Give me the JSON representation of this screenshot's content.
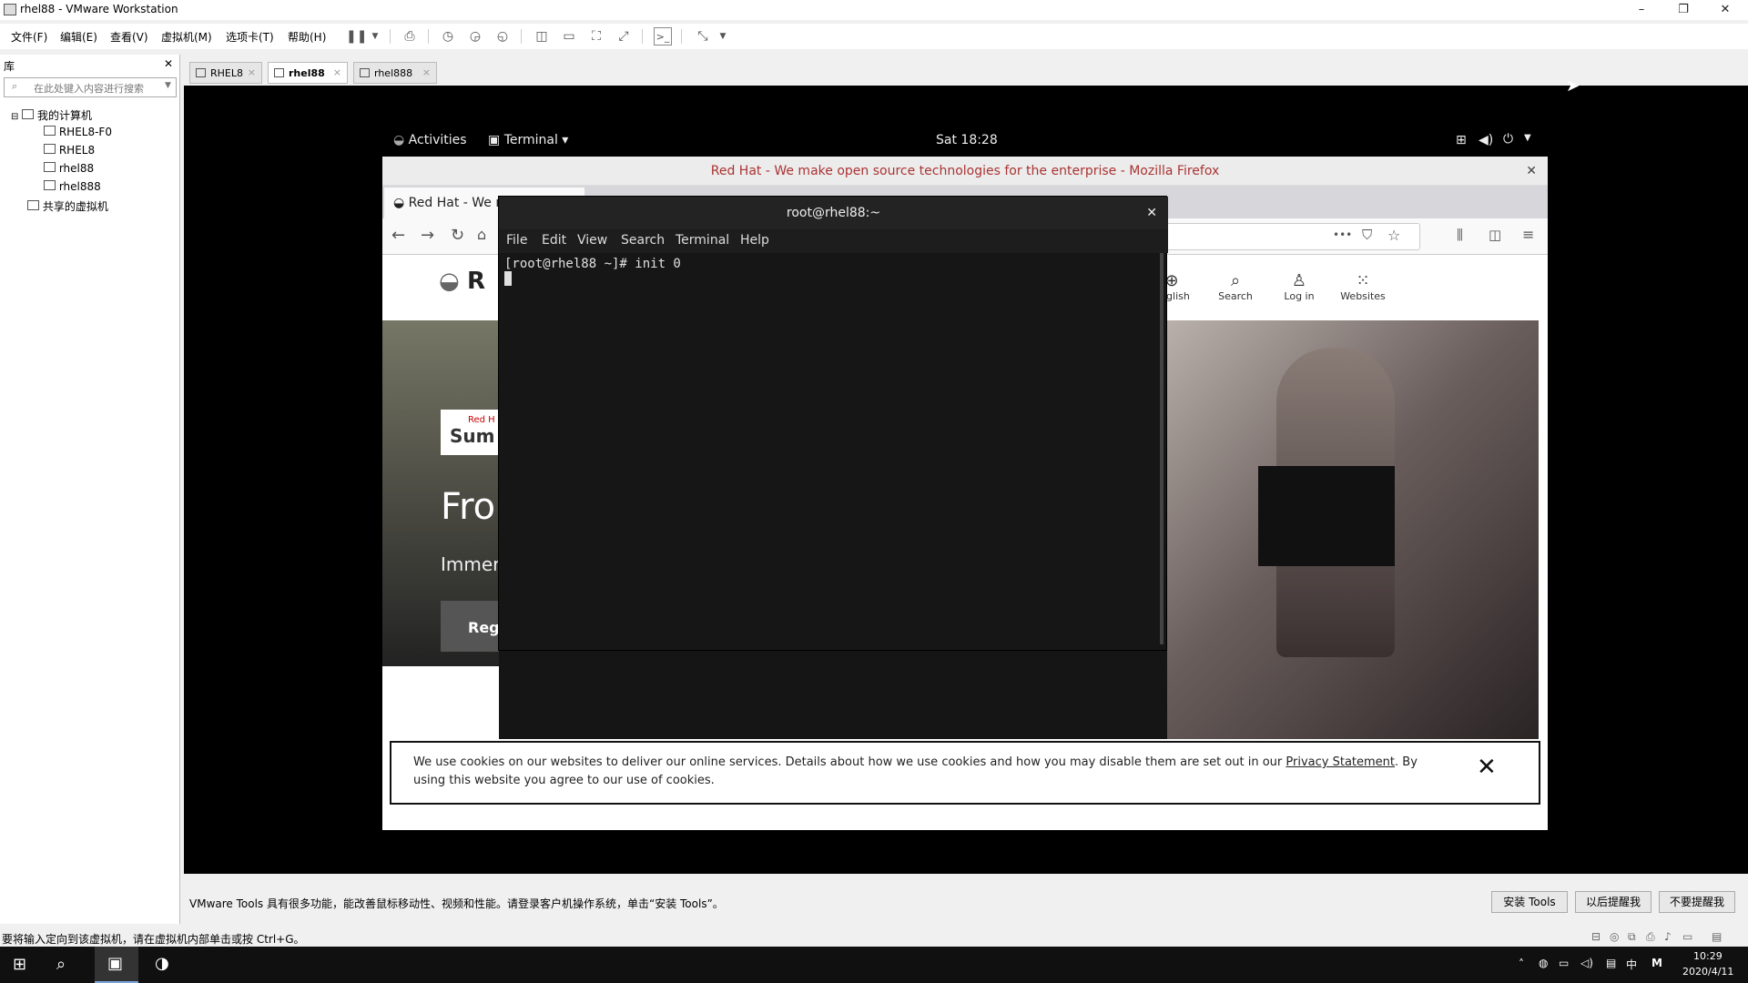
{
  "window": {
    "title": "rhel88 - VMware Workstation",
    "minimize": "–",
    "maximize": "❐",
    "close": "✕"
  },
  "menubar": {
    "items": [
      "文件(F)",
      "编辑(E)",
      "查看(V)",
      "虚拟机(M)",
      "选项卡(T)",
      "帮助(H)"
    ]
  },
  "library": {
    "title": "库",
    "close": "✕",
    "search_placeholder": "在此处键入内容进行搜索",
    "tree": {
      "root": "我的计算机",
      "items": [
        "RHEL8-F0",
        "RHEL8",
        "rhel88",
        "rhel888"
      ],
      "shared": "共享的虚拟机"
    }
  },
  "tabs": [
    {
      "label": "RHEL8"
    },
    {
      "label": "rhel88"
    },
    {
      "label": "rhel888"
    }
  ],
  "gnome": {
    "activities": "Activities",
    "app": "Terminal ▾",
    "clock": "Sat 18:28"
  },
  "firefox": {
    "title": "Red Hat - We make open source technologies for the enterprise - Mozilla Firefox",
    "tab_label": "Red Hat - We m",
    "more": "•••",
    "site_nav": [
      "English",
      "Search",
      "Log in",
      "Websites"
    ],
    "logo_text": "R",
    "summit_badge": "Red H",
    "summit_word": "Sum",
    "headline": "Fro",
    "subline": "Immer",
    "register": "Reg",
    "cookie_text_before": "We use cookies on our websites to deliver our online services. Details about how we use cookies and how you may disable them are set out in our ",
    "cookie_link": "Privacy Statement",
    "cookie_text_after": ". By using this website you agree to our use of cookies.",
    "cookie_close": "✕"
  },
  "terminal": {
    "title": "root@rhel88:~",
    "close": "✕",
    "menu": [
      "File",
      "Edit",
      "View",
      "Search",
      "Terminal",
      "Help"
    ],
    "prompt_line": "[root@rhel88 ~]# init 0"
  },
  "tools_bar": {
    "message": "VMware Tools 具有很多功能，能改善鼠标移动性、视频和性能。请登录客户机操作系统，单击“安装 Tools”。",
    "install": "安装 Tools",
    "later": "以后提醒我",
    "never": "不要提醒我"
  },
  "statusbar": {
    "text": "要将输入定向到该虚拟机，请在虚拟机内部单击或按 Ctrl+G。"
  },
  "taskbar": {
    "time": "10:29",
    "date": "2020/4/11",
    "ime": "中",
    "ime2": "M"
  }
}
